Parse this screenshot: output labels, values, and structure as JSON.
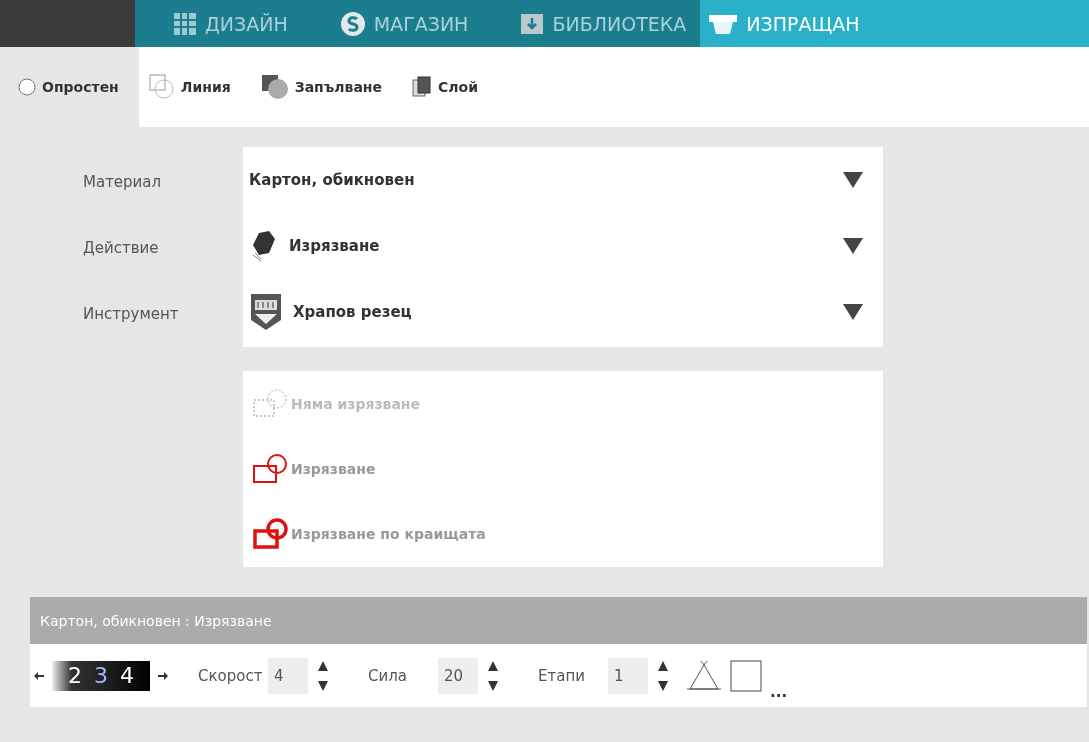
{
  "tabs": [
    {
      "label": "ДИЗАЙН",
      "kind": "grid",
      "selected": false
    },
    {
      "label": "МАГАЗИН",
      "kind": "store",
      "selected": false
    },
    {
      "label": "БИБЛИОТЕКА",
      "kind": "library",
      "selected": false
    },
    {
      "label": "ИЗПРАЩАН",
      "kind": "send",
      "selected": true
    }
  ],
  "subtabs": [
    {
      "label": "Опростен",
      "kind": "radio",
      "selected": true
    },
    {
      "label": "Линия",
      "kind": "line",
      "selected": false
    },
    {
      "label": "Запълване",
      "kind": "fill",
      "selected": false
    },
    {
      "label": "Слой",
      "kind": "layer",
      "selected": false
    }
  ],
  "settings": [
    {
      "label": "Материал",
      "value": "Картон, обикновен",
      "kind": "plain"
    },
    {
      "label": "Действие",
      "value": "Изрязване",
      "kind": "blade"
    },
    {
      "label": "Инструмент",
      "value": "Храпов резец",
      "kind": "tool"
    }
  ],
  "cut_styles": [
    {
      "label": "Няма изрязване",
      "kind": "none",
      "disabled": true
    },
    {
      "label": "Изрязване",
      "kind": "cut",
      "disabled": false
    },
    {
      "label": "Изрязване по краищата",
      "kind": "edge",
      "disabled": false
    }
  ],
  "summary": {
    "title": "Картон, обикновен : Изрязване",
    "dial_digits": [
      {
        "digit": "2",
        "selected": false
      },
      {
        "digit": "3",
        "selected": true
      },
      {
        "digit": "4",
        "selected": false
      }
    ],
    "fields": [
      {
        "label": "Скорост",
        "value": "4"
      },
      {
        "label": "Сила",
        "value": "20"
      },
      {
        "label": "Етапи",
        "value": "1"
      }
    ],
    "more": "..."
  }
}
